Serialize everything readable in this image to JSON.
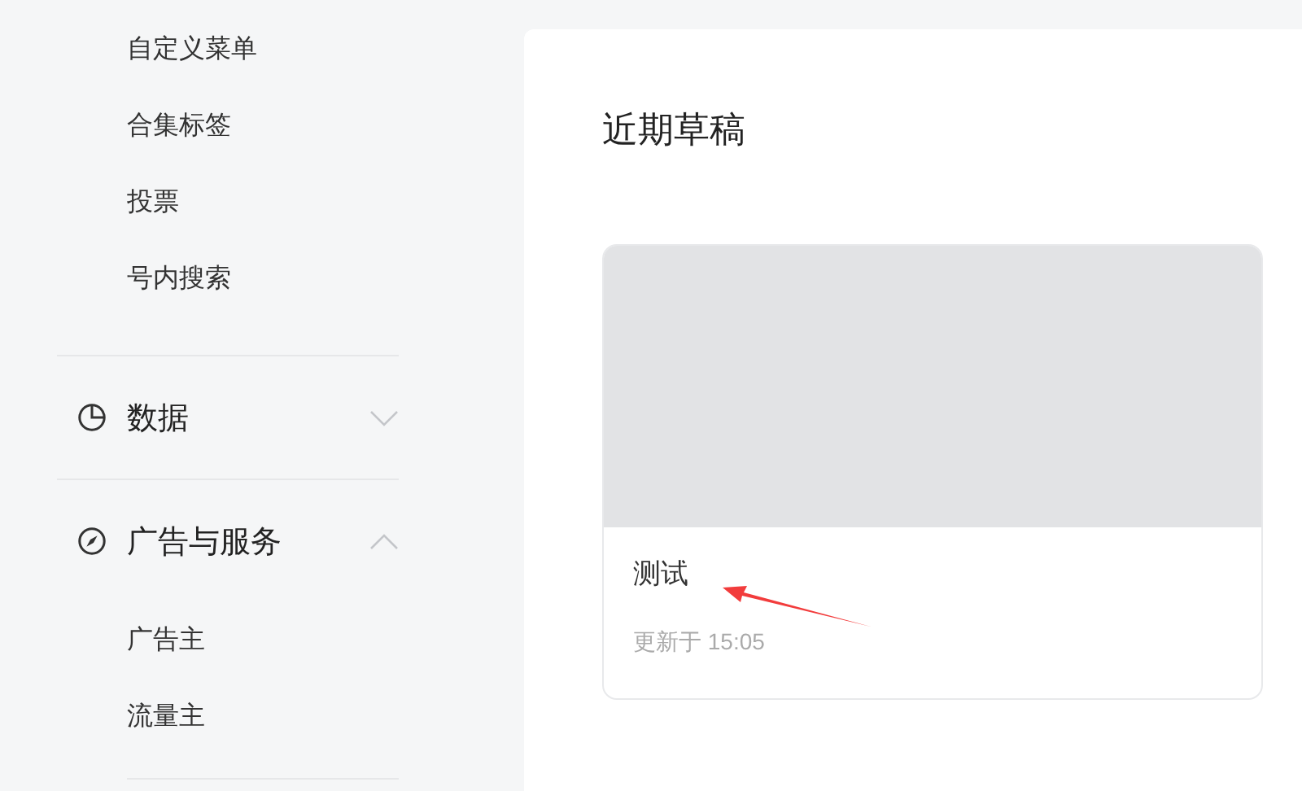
{
  "sidebar": {
    "items": [
      {
        "label": "自定义菜单"
      },
      {
        "label": "合集标签"
      },
      {
        "label": "投票"
      },
      {
        "label": "号内搜索"
      }
    ],
    "sections": [
      {
        "label": "数据",
        "expanded": false
      },
      {
        "label": "广告与服务",
        "expanded": true,
        "children": [
          {
            "label": "广告主"
          },
          {
            "label": "流量主"
          }
        ]
      }
    ]
  },
  "main": {
    "title": "近期草稿",
    "drafts": [
      {
        "kind": "picture",
        "title": "测试",
        "updated": "更新于 15:05"
      }
    ]
  }
}
